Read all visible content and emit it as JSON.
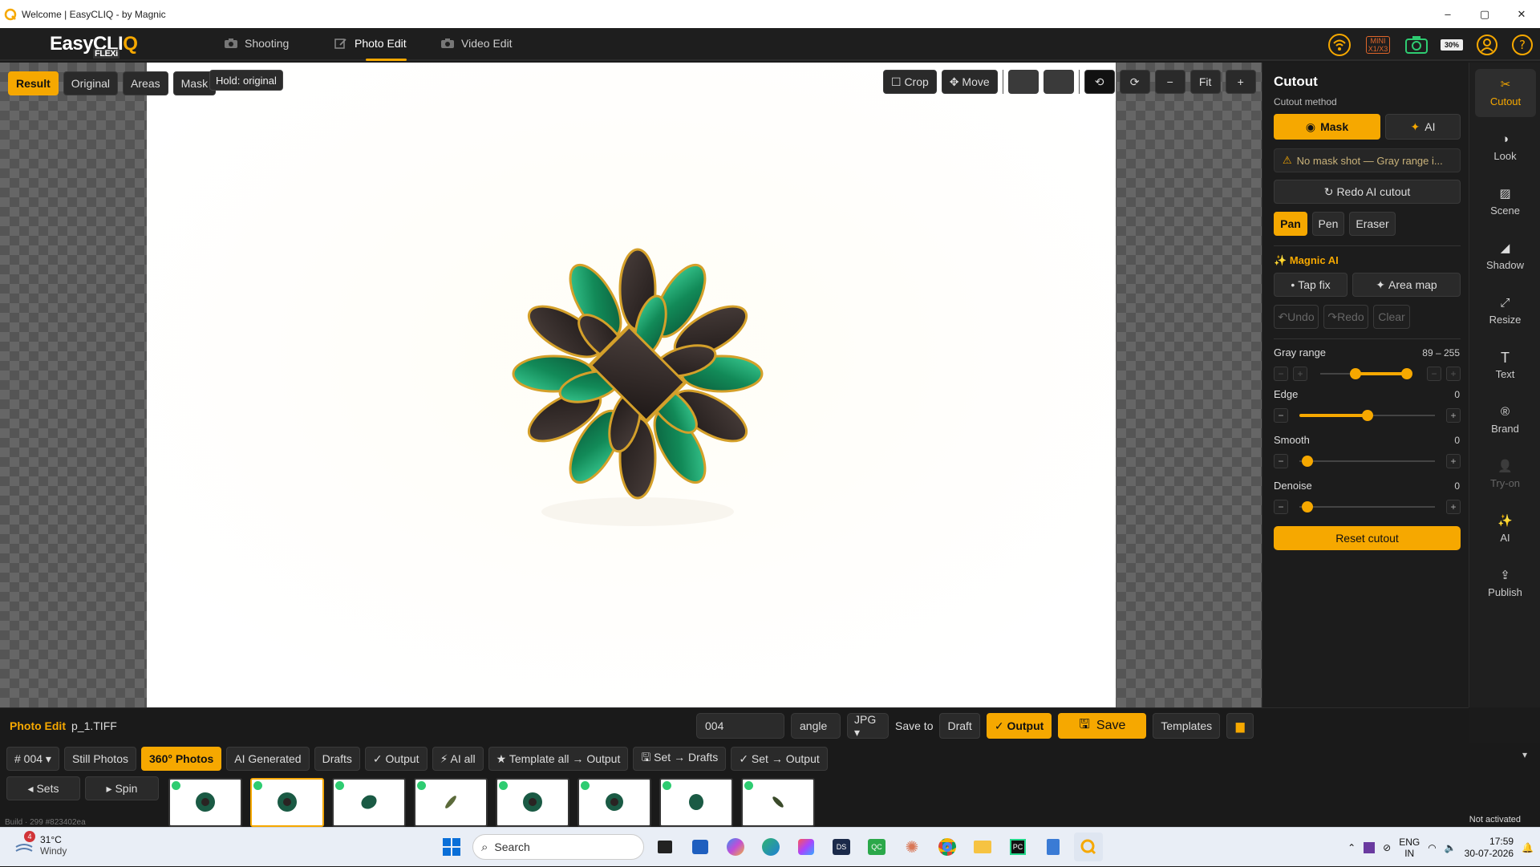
{
  "window": {
    "title": "Welcome | EasyCLIQ - by Magnic",
    "minimize": "–",
    "maximize": "▢",
    "close": "✕"
  },
  "brand": {
    "name_a": "EasyCLI",
    "name_b": "Q",
    "sub": "FLEXi"
  },
  "nav": {
    "tabs": [
      {
        "label": "Shooting",
        "active": false
      },
      {
        "label": "Photo Edit",
        "active": true
      },
      {
        "label": "Video Edit",
        "active": false
      }
    ]
  },
  "status_icons": [
    "wifi-icon",
    "mini-x1x3-badge",
    "camera-icon",
    "battery-icon",
    "user-icon",
    "help-icon"
  ],
  "status": {
    "mini_label_1": "MINI",
    "mini_label_2": "X1/X3",
    "battery": "30%"
  },
  "view_tabs": [
    {
      "label": "Result",
      "active": true
    },
    {
      "label": "Original",
      "active": false
    },
    {
      "label": "Areas",
      "active": false
    },
    {
      "label": "Mask",
      "active": false
    }
  ],
  "hold_label": "Hold: original",
  "canvas_tools": {
    "crop": "☐ Crop",
    "move": "✥ Move",
    "rotate_left": "⟲",
    "rotate_right": "⟳",
    "zoom_out": "−",
    "fit": "Fit",
    "zoom_in": "+"
  },
  "right_panel": {
    "title": "Cutout",
    "method_label": "Cutout method",
    "method_mask": "Mask",
    "method_ai": "AI",
    "warning": "No mask shot — Gray range i...",
    "redo": "Redo AI cutout",
    "tools": [
      {
        "label": "Pan",
        "active": true
      },
      {
        "label": "Pen",
        "active": false
      },
      {
        "label": "Eraser",
        "active": false
      }
    ],
    "magnic_ai": "Magnic AI",
    "tap_fix": "Tap fix",
    "area_map": "Area map",
    "undo": "Undo",
    "redo_small": "Redo",
    "clear": "Clear",
    "sliders": [
      {
        "label": "Gray range",
        "value": "89 – 255",
        "low": 89,
        "high": 255,
        "max": 255
      },
      {
        "label": "Edge",
        "value": "0"
      },
      {
        "label": "Smooth",
        "value": "0"
      },
      {
        "label": "Denoise",
        "value": "0"
      }
    ],
    "reset": "Reset cutout"
  },
  "side_nav": [
    {
      "label": "Cutout",
      "icon": "scissors-icon",
      "glyph": "✂",
      "active": true,
      "disabled": false
    },
    {
      "label": "Look",
      "icon": "contrast-icon",
      "glyph": "◑",
      "active": false,
      "disabled": false
    },
    {
      "label": "Scene",
      "icon": "scene-icon",
      "glyph": "▨",
      "active": false,
      "disabled": false
    },
    {
      "label": "Shadow",
      "icon": "shadow-icon",
      "glyph": "◢",
      "active": false,
      "disabled": false
    },
    {
      "label": "Resize",
      "icon": "resize-icon",
      "glyph": "⤢",
      "active": false,
      "disabled": false
    },
    {
      "label": "Text",
      "icon": "text-icon",
      "glyph": "T",
      "active": false,
      "disabled": false
    },
    {
      "label": "Brand",
      "icon": "brand-icon",
      "glyph": "®",
      "active": false,
      "disabled": false
    },
    {
      "label": "Try-on",
      "icon": "person-icon",
      "glyph": "👤",
      "active": false,
      "disabled": true
    },
    {
      "label": "AI",
      "icon": "sparkle-icon",
      "glyph": "✨",
      "active": false,
      "disabled": false
    },
    {
      "label": "Publish",
      "icon": "publish-icon",
      "glyph": "⇪",
      "active": false,
      "disabled": false
    }
  ],
  "bottom": {
    "section": "Photo Edit",
    "file": "p_1.TIFF",
    "name_value": "004",
    "angle_placeholder": "angle",
    "format": "JPG ▾",
    "save_to": "Save to",
    "draft": "Draft",
    "output": "✓ Output",
    "save": "Save",
    "templates": "Templates"
  },
  "set_tabs": [
    {
      "label": "# 004 ▾",
      "active": false
    },
    {
      "label": "Still Photos",
      "active": false
    },
    {
      "label": "360° Photos",
      "active": true
    },
    {
      "label": "AI Generated",
      "active": false
    },
    {
      "label": "Drafts",
      "active": false
    },
    {
      "label": "✓ Output",
      "active": false
    },
    {
      "label": "⚡ AI all",
      "active": false
    },
    {
      "label": "★ Template all → Output",
      "active": false
    },
    {
      "label": "🖫 Set → Drafts",
      "active": false
    },
    {
      "label": "✓ Set → Output",
      "active": false
    }
  ],
  "collapse": "▾",
  "sets_btn": "◂ Sets",
  "spin_btn": "▸ Spin",
  "thumbnails": [
    {
      "selected": false
    },
    {
      "selected": true
    },
    {
      "selected": false
    },
    {
      "selected": false
    },
    {
      "selected": false
    },
    {
      "selected": false
    },
    {
      "selected": false
    },
    {
      "selected": false
    }
  ],
  "build": "Build · 299 #823402ea",
  "not_activated": "Not activated",
  "taskbar": {
    "badge": "4",
    "temp": "31°C",
    "weather": "Windy",
    "search": "Search",
    "lang_1": "ENG",
    "lang_2": "IN",
    "time": "17:59",
    "date": "30-07-2026"
  },
  "colors": {
    "accent": "#f6a800",
    "panel": "#1c1c1c",
    "emerald": "#1f9e6a",
    "stone_dark": "#2a2322",
    "gold": "#d4a02a"
  }
}
